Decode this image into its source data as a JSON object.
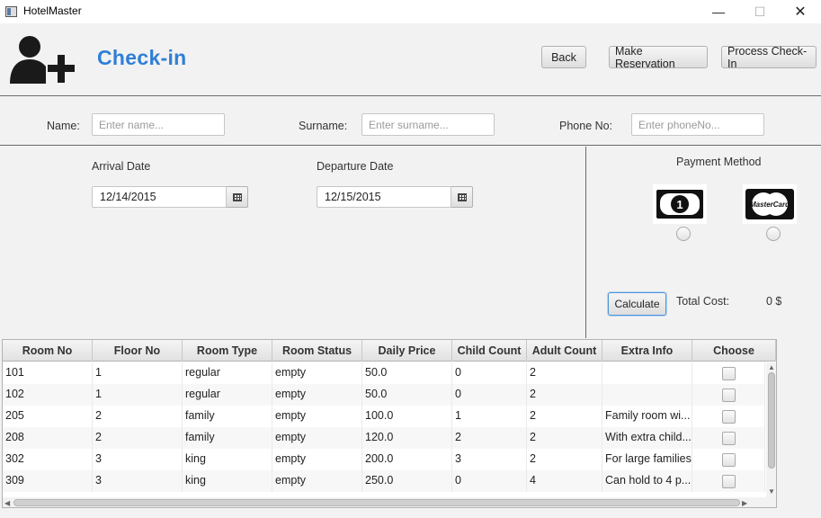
{
  "window": {
    "title": "HotelMaster",
    "minimize": "—",
    "maximize": "☐",
    "close": "✕"
  },
  "header": {
    "title": "Check-in",
    "buttons": {
      "back": "Back",
      "make_reservation": "Make Reservation",
      "process_checkin": "Process Check-In"
    }
  },
  "guest": {
    "name_label": "Name:",
    "name_placeholder": "Enter name...",
    "surname_label": "Surname:",
    "surname_placeholder": "Enter surname...",
    "phone_label": "Phone No:",
    "phone_placeholder": "Enter phoneNo..."
  },
  "dates": {
    "arrival_label": "Arrival Date",
    "arrival_value": "12/14/2015",
    "departure_label": "Departure Date",
    "departure_value": "12/15/2015"
  },
  "payment": {
    "label": "Payment Method",
    "options": [
      "cash-icon",
      "mastercard-icon"
    ],
    "cash_digit": "1",
    "mastercard_text": "MasterCard",
    "calculate_label": "Calculate",
    "total_cost_label": "Total Cost:",
    "total_cost_value": "0 $"
  },
  "table": {
    "columns": [
      "Room No",
      "Floor No",
      "Room Type",
      "Room Status",
      "Daily Price",
      "Child Count",
      "Adult Count",
      "Extra Info",
      "Choose"
    ],
    "rows": [
      [
        "101",
        "1",
        "regular",
        "empty",
        "50.0",
        "0",
        "2",
        ""
      ],
      [
        "102",
        "1",
        "regular",
        "empty",
        "50.0",
        "0",
        "2",
        ""
      ],
      [
        "205",
        "2",
        "family",
        "empty",
        "100.0",
        "1",
        "2",
        "Family room wi..."
      ],
      [
        "208",
        "2",
        "family",
        "empty",
        "120.0",
        "2",
        "2",
        "With extra child..."
      ],
      [
        "302",
        "3",
        "king",
        "empty",
        "200.0",
        "3",
        "2",
        "For large families"
      ],
      [
        "309",
        "3",
        "king",
        "empty",
        "250.0",
        "0",
        "4",
        "Can hold to 4 p..."
      ]
    ]
  },
  "colors": {
    "title_accent": "#2f7fd7",
    "focus_border": "#4f93d6"
  }
}
